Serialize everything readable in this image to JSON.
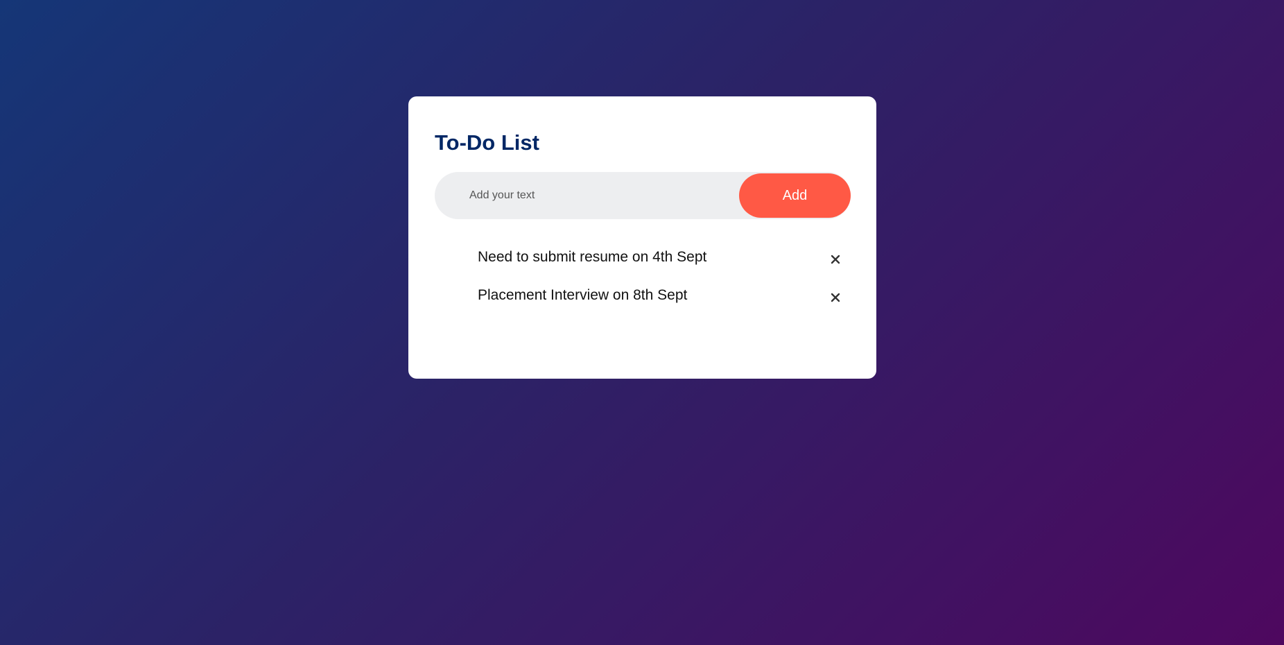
{
  "app": {
    "title": "To-Do List"
  },
  "input": {
    "placeholder": "Add your text",
    "value": ""
  },
  "add_button": {
    "label": "Add"
  },
  "tasks": [
    {
      "text": "Need to submit resume on 4th Sept",
      "icon": "close-icon"
    },
    {
      "text": "Placement Interview on 8th Sept",
      "icon": "close-icon"
    }
  ],
  "colors": {
    "accent": "#ff5945",
    "title": "#002765",
    "background_start": "#153677",
    "background_end": "#4e085f"
  }
}
